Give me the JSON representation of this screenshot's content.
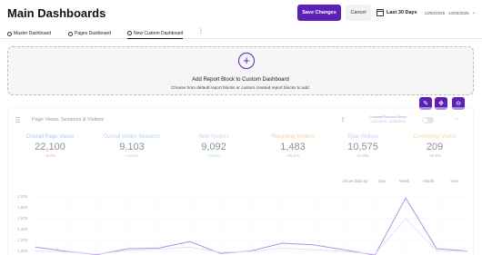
{
  "header": {
    "title": "Main Dashboards",
    "save_label": "Save Changes",
    "cancel_label": "Cancel",
    "range_label": "Last 30 Days",
    "range_dates": "13/02/2025 - 14/03/2025"
  },
  "tabs": [
    {
      "label": "Master Dashboard"
    },
    {
      "label": "Pages Dashboard"
    },
    {
      "label": "New Custom Dashboard"
    }
  ],
  "tab_menu": "⋮",
  "add_block": {
    "plus": "+",
    "title": "Add Report Block to Custom Dashboard",
    "subtitle": "Choose from default report blocks or custom created report blocks to add."
  },
  "tools": [
    {
      "icon": "pencil-icon",
      "glyph": "✎"
    },
    {
      "icon": "move-icon",
      "glyph": "✥"
    },
    {
      "icon": "minus-icon",
      "glyph": "⊖"
    }
  ],
  "report": {
    "title": "Page Views, Sessions & Visitors",
    "compare_label": "Compare Previous Period",
    "compare_dates": "12/01/2025 - 12/02/2025",
    "share_glyph": "⇪",
    "more_glyph": "⋯",
    "metrics": [
      {
        "label": "Overall Page Views",
        "value": "22,100",
        "change": "-4.8%",
        "color": "#5b8def",
        "change_color": "#e74c3c"
      },
      {
        "label": "Overall Visitor Sessions",
        "value": "9,103",
        "change": "+14.3%",
        "color": "#6fa8dc",
        "change_color": "#2ecc71"
      },
      {
        "label": "New Visitors",
        "value": "9,092",
        "change": "+18.2%",
        "color": "#c792ea",
        "change_color": "#2ecc71"
      },
      {
        "label": "Returning Visitors",
        "value": "1,483",
        "change": "-25.1%",
        "color": "#f39c4f",
        "change_color": "#e74c3c"
      },
      {
        "label": "Total Visitors",
        "value": "10,575",
        "change": "-3.23%",
        "color": "#a78bfa",
        "change_color": "#e74c3c"
      },
      {
        "label": "Converting Visitor",
        "value": "209",
        "change": "-50.5%",
        "color": "#f0b429",
        "change_color": "#e74c3c"
      }
    ],
    "granularity": [
      "Show data by",
      "Day",
      "Week",
      "Month",
      "Year"
    ],
    "granularity_selected": "Day",
    "y_ticks": [
      "2,000",
      "1,800",
      "1,600",
      "1,400",
      "1,200",
      "1,000"
    ]
  },
  "chart_data": {
    "type": "line",
    "y_ticks": [
      2000,
      1800,
      1600,
      1400,
      1200,
      1000
    ],
    "series": [
      {
        "color": "#6d28d9",
        "values": [
          1080,
          1000,
          940,
          1050,
          1060,
          1180,
          960,
          1010,
          1150,
          1120,
          1030,
          930,
          1980,
          1050,
          1005
        ]
      },
      {
        "color": "#c4b5fd",
        "values": [
          1010,
          990,
          950,
          1020,
          1040,
          1080,
          980,
          1000,
          1060,
          1030,
          1000,
          950,
          1600,
          1010,
          1000
        ]
      }
    ]
  }
}
